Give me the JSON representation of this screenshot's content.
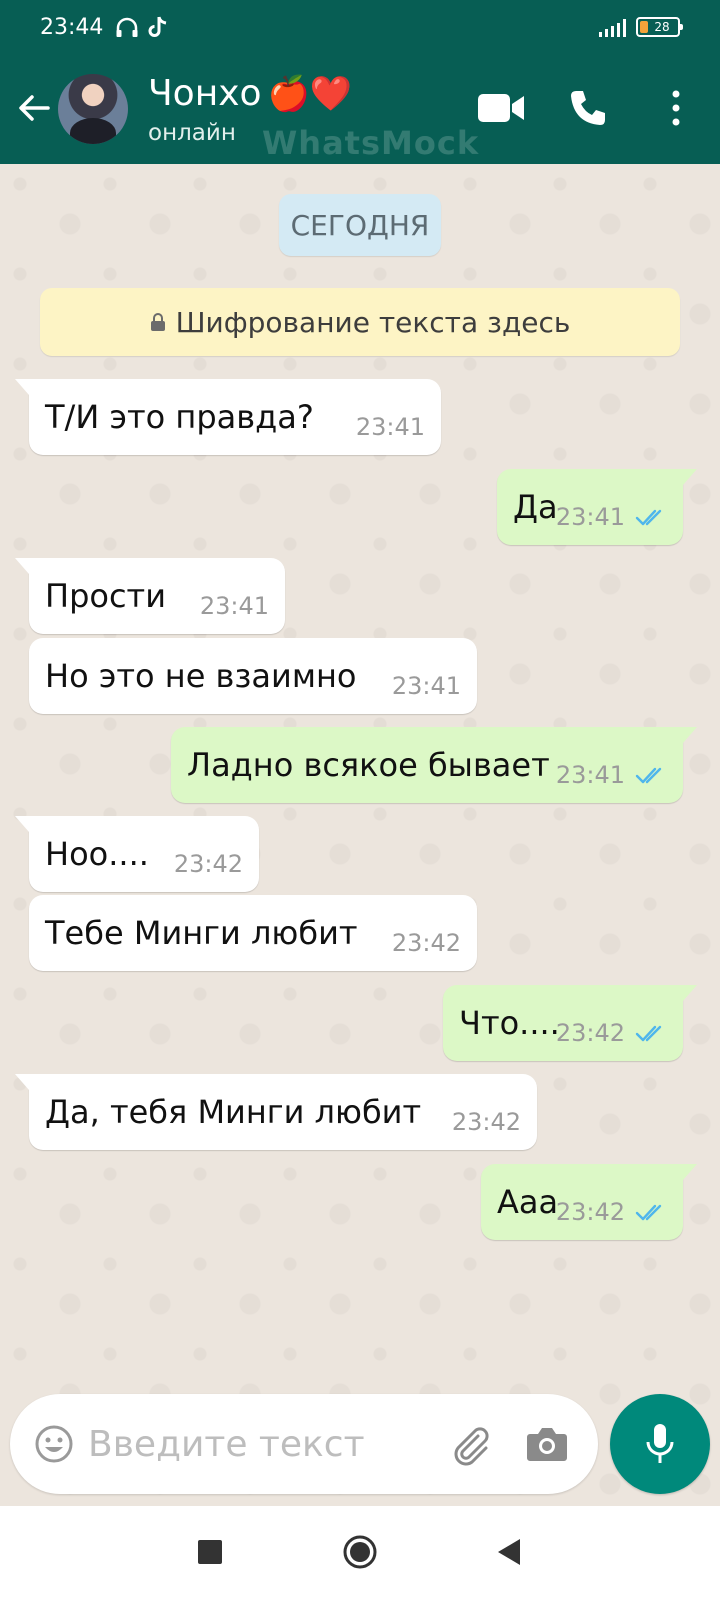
{
  "status_bar": {
    "time": "23:44",
    "left_icons": [
      "headphones-icon",
      "tiktok-icon"
    ],
    "battery": "28",
    "accent_color": "#f2a33a"
  },
  "header": {
    "contact_name": "Чонхо",
    "name_emoji": "🍎❤️",
    "status": "онлайн",
    "watermark": "WhatsMock",
    "background_color": "#075e54",
    "icons": [
      "back-arrow-icon",
      "video-call-icon",
      "phone-icon",
      "more-vert-icon"
    ]
  },
  "chat": {
    "date_label": "СЕГОДНЯ",
    "encryption_notice": "Шифрование текста здесь",
    "messages": [
      {
        "dir": "in",
        "text": "Т/И это правда?",
        "time": "23:41"
      },
      {
        "dir": "out",
        "text": "Да",
        "time": "23:41",
        "read": true
      },
      {
        "dir": "in",
        "text": "Прости",
        "time": "23:41"
      },
      {
        "dir": "in",
        "text": "Но это не взаимно",
        "time": "23:41"
      },
      {
        "dir": "out",
        "text": "Ладно всякое бывает",
        "time": "23:41",
        "read": true
      },
      {
        "dir": "in",
        "text": "Ноо....",
        "time": "23:42"
      },
      {
        "dir": "in",
        "text": "Тебе Минги любит",
        "time": "23:42"
      },
      {
        "dir": "out",
        "text": "Что....",
        "time": "23:42",
        "read": true
      },
      {
        "dir": "in",
        "text": "Да, тебя Минги любит",
        "time": "23:42"
      },
      {
        "dir": "out",
        "text": "Ааа",
        "time": "23:42",
        "read": true
      }
    ],
    "incoming_color": "#ffffff",
    "outgoing_color": "#dcf8c6",
    "read_tick_color": "#4fb6ec"
  },
  "composer": {
    "placeholder": "Введите текст",
    "icons": [
      "emoji-icon",
      "attach-icon",
      "camera-icon",
      "mic-icon"
    ],
    "mic_color": "#00897b"
  },
  "nav_bar": {
    "icons": [
      "recents-square-icon",
      "home-circle-icon",
      "back-triangle-icon"
    ]
  }
}
